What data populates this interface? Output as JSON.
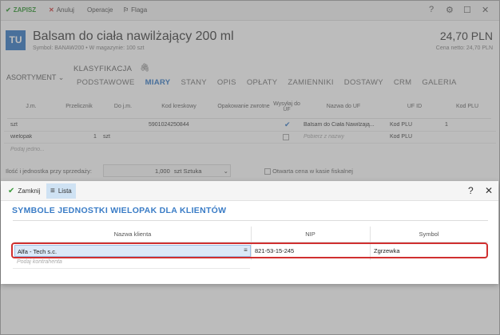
{
  "toolbar": {
    "save": "ZAPISZ",
    "cancel": "Anuluj",
    "operations": "Operacje",
    "flag": "Flaga",
    "help": "?",
    "settings": "⚙",
    "maximize": "☐",
    "close": "✕"
  },
  "product": {
    "badge": "TU",
    "name": "Balsam do ciała nawilżający 200 ml",
    "subline": "Symbol: BANAW200  •  W magazynie: 100 szt",
    "price": "24,70 PLN",
    "price_sub": "Cena netto: 24,70 PLN"
  },
  "nav": {
    "left": "ASORTYMENT",
    "top_tab": "KLASYFIKACJA",
    "tabs": [
      "PODSTAWOWE",
      "MIARY",
      "STANY",
      "OPIS",
      "OPŁATY",
      "ZAMIENNIKI",
      "DOSTAWY",
      "CRM",
      "GALERIA"
    ],
    "active_tab": "MIARY"
  },
  "grid": {
    "headers": [
      "J.m.",
      "Przelicznik",
      "Do j.m.",
      "Kod kreskowy",
      "Opakowanie zwrotne",
      "Wysyłaj do UF",
      "Nazwa do UF",
      "UF ID",
      "Kod PLU"
    ],
    "rows": [
      {
        "jm": "szt",
        "przelicznik": "",
        "do_jm": "",
        "kod": "5901024250844",
        "uf_name": "Balsam do Ciała Nawilżają...",
        "uf_id": "Kod PLU",
        "plu": "1"
      },
      {
        "jm": "wielopak",
        "przelicznik": "1",
        "do_jm": "szt",
        "kod": "",
        "uf_name": "Pobierz z nazwy",
        "uf_id": "Kod PLU",
        "plu": ""
      }
    ],
    "add_placeholder": "Podaj jedno..."
  },
  "sale_unit": {
    "label": "Ilość i jednostka przy sprzedaży:",
    "qty": "1,000",
    "unit": "szt Sztuka",
    "open_price": "Otwarta cena w kasie fiskalnej"
  },
  "dialog": {
    "close": "Zamknij",
    "list": "Lista",
    "help": "?",
    "x": "✕",
    "title": "SYMBOLE JEDNOSTKI WIELOPAK DLA KLIENTÓW",
    "columns": [
      "Nazwa klienta",
      "NIP",
      "Symbol"
    ],
    "row": {
      "client": "Alfa - Tech s.c.",
      "nip": "821-53-15-245",
      "symbol": "Zgrzewka"
    },
    "placeholder": "Podaj kontrahenta"
  },
  "colors": {
    "accent": "#3a7cc6",
    "highlight_border": "#d03030",
    "save_green": "#3a9a3a",
    "cancel_red": "#d04040"
  }
}
